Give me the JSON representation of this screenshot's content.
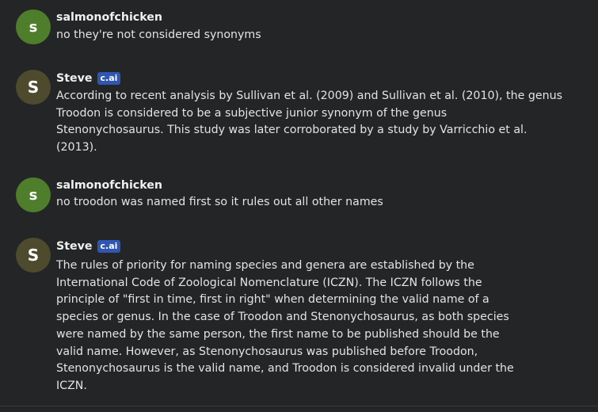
{
  "messages": [
    {
      "author": "salmonofchicken",
      "avatar_letter": "s",
      "badge": "",
      "text": "no they're not considered synonyms"
    },
    {
      "author": "Steve",
      "avatar_letter": "S",
      "badge": "c.ai",
      "text": "According to recent analysis by Sullivan et al. (2009) and Sullivan et al. (2010), the genus\nTroodon is considered to be a subjective junior synonym of the genus\nStenonychosaurus. This study was later corroborated by a study by Varricchio et al.\n(2013)."
    },
    {
      "author": "salmonofchicken",
      "avatar_letter": "s",
      "badge": "",
      "text": "no troodon was named first so it rules out all other names"
    },
    {
      "author": "Steve",
      "avatar_letter": "S",
      "badge": "c.ai",
      "text": "The rules of priority for naming species and genera are established by the\nInternational Code of Zoological Nomenclature (ICZN). The ICZN follows the\nprinciple of \"first in time, first in right\" when determining the valid name of a\nspecies or genus. In the case of Troodon and Stenonychosaurus, as both species\nwere named by the same person, the first name to be published should be the\nvalid name. However, as Stenonychosaurus was published before Troodon,\nStenonychosaurus is the valid name, and Troodon is considered invalid under the\nICZN."
    }
  ],
  "colors": {
    "background": "#242526",
    "user_avatar": "#4e7d2b",
    "bot_avatar": "#4d4a2d",
    "badge": "#2f56b0"
  }
}
